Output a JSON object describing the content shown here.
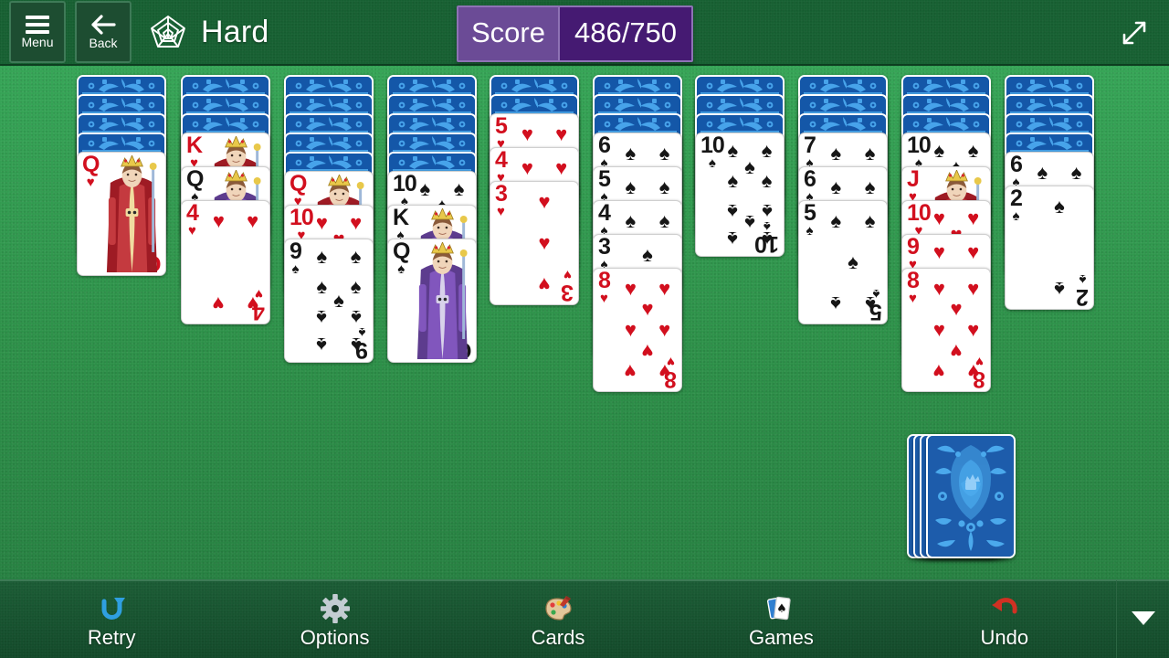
{
  "header": {
    "menu_label": "Menu",
    "back_label": "Back",
    "game_icon": "spider-web-icon",
    "title": "Hard",
    "score_label": "Score",
    "score_value": "486/750",
    "score_current": 486,
    "score_total": 750,
    "fullscreen_icon": "expand-diagonal-icon"
  },
  "colors": {
    "felt": "#2e9a4d",
    "header_green": "#176032",
    "bar_green": "#16522f",
    "score_label_purple": "#6b4b96",
    "score_value_purple": "#451a72",
    "card_back_blue": "#1154a8",
    "red_suit": "#d20f1e",
    "black_suit": "#161616"
  },
  "table": {
    "columns": [
      {
        "index": 1,
        "facedown": 4,
        "faceup": [
          {
            "rank": "Q",
            "suit": "hearts",
            "color": "red",
            "court": true
          }
        ]
      },
      {
        "index": 2,
        "facedown": 3,
        "faceup": [
          {
            "rank": "K",
            "suit": "hearts",
            "color": "red",
            "court": true
          },
          {
            "rank": "Q",
            "suit": "spades",
            "color": "black",
            "court": true
          },
          {
            "rank": "4",
            "suit": "hearts",
            "color": "red",
            "court": false
          }
        ]
      },
      {
        "index": 3,
        "facedown": 5,
        "faceup": [
          {
            "rank": "Q",
            "suit": "hearts",
            "color": "red",
            "court": true
          },
          {
            "rank": "10",
            "suit": "hearts",
            "color": "red",
            "court": false
          },
          {
            "rank": "9",
            "suit": "spades",
            "color": "black",
            "court": false
          }
        ]
      },
      {
        "index": 4,
        "facedown": 5,
        "faceup": [
          {
            "rank": "10",
            "suit": "spades",
            "color": "black",
            "court": false
          },
          {
            "rank": "K",
            "suit": "spades",
            "color": "black",
            "court": true
          },
          {
            "rank": "Q",
            "suit": "spades",
            "color": "black",
            "court": true
          }
        ]
      },
      {
        "index": 5,
        "facedown": 2,
        "faceup": [
          {
            "rank": "5",
            "suit": "hearts",
            "color": "red",
            "court": false
          },
          {
            "rank": "4",
            "suit": "hearts",
            "color": "red",
            "court": false
          },
          {
            "rank": "3",
            "suit": "hearts",
            "color": "red",
            "court": false
          }
        ]
      },
      {
        "index": 6,
        "facedown": 3,
        "faceup": [
          {
            "rank": "6",
            "suit": "spades",
            "color": "black",
            "court": false
          },
          {
            "rank": "5",
            "suit": "spades",
            "color": "black",
            "court": false
          },
          {
            "rank": "4",
            "suit": "spades",
            "color": "black",
            "court": false
          },
          {
            "rank": "3",
            "suit": "spades",
            "color": "black",
            "court": false
          },
          {
            "rank": "8",
            "suit": "hearts",
            "color": "red",
            "court": false
          }
        ]
      },
      {
        "index": 7,
        "facedown": 3,
        "faceup": [
          {
            "rank": "10",
            "suit": "spades",
            "color": "black",
            "court": false
          }
        ]
      },
      {
        "index": 8,
        "facedown": 3,
        "faceup": [
          {
            "rank": "7",
            "suit": "spades",
            "color": "black",
            "court": false
          },
          {
            "rank": "6",
            "suit": "spades",
            "color": "black",
            "court": false
          },
          {
            "rank": "5",
            "suit": "spades",
            "color": "black",
            "court": false
          }
        ]
      },
      {
        "index": 9,
        "facedown": 3,
        "faceup": [
          {
            "rank": "10",
            "suit": "spades",
            "color": "black",
            "court": false
          },
          {
            "rank": "J",
            "suit": "hearts",
            "color": "red",
            "court": true
          },
          {
            "rank": "10",
            "suit": "hearts",
            "color": "red",
            "court": false
          },
          {
            "rank": "9",
            "suit": "hearts",
            "color": "red",
            "court": false
          },
          {
            "rank": "8",
            "suit": "hearts",
            "color": "red",
            "court": false
          }
        ]
      },
      {
        "index": 10,
        "facedown": 4,
        "faceup": [
          {
            "rank": "6",
            "suit": "spades",
            "color": "black",
            "court": false
          },
          {
            "rank": "2",
            "suit": "spades",
            "color": "black",
            "court": false
          }
        ]
      }
    ],
    "stock": {
      "piles": 4,
      "name": "stock-pile"
    }
  },
  "bottombar": {
    "items": [
      {
        "label": "Retry",
        "icon": "retry-circular-arrow-icon"
      },
      {
        "label": "Options",
        "icon": "gear-icon"
      },
      {
        "label": "Cards",
        "icon": "palette-icon"
      },
      {
        "label": "Games",
        "icon": "playing-cards-icon"
      },
      {
        "label": "Undo",
        "icon": "undo-arrow-icon"
      }
    ],
    "expand_icon": "chevron-down-icon"
  }
}
